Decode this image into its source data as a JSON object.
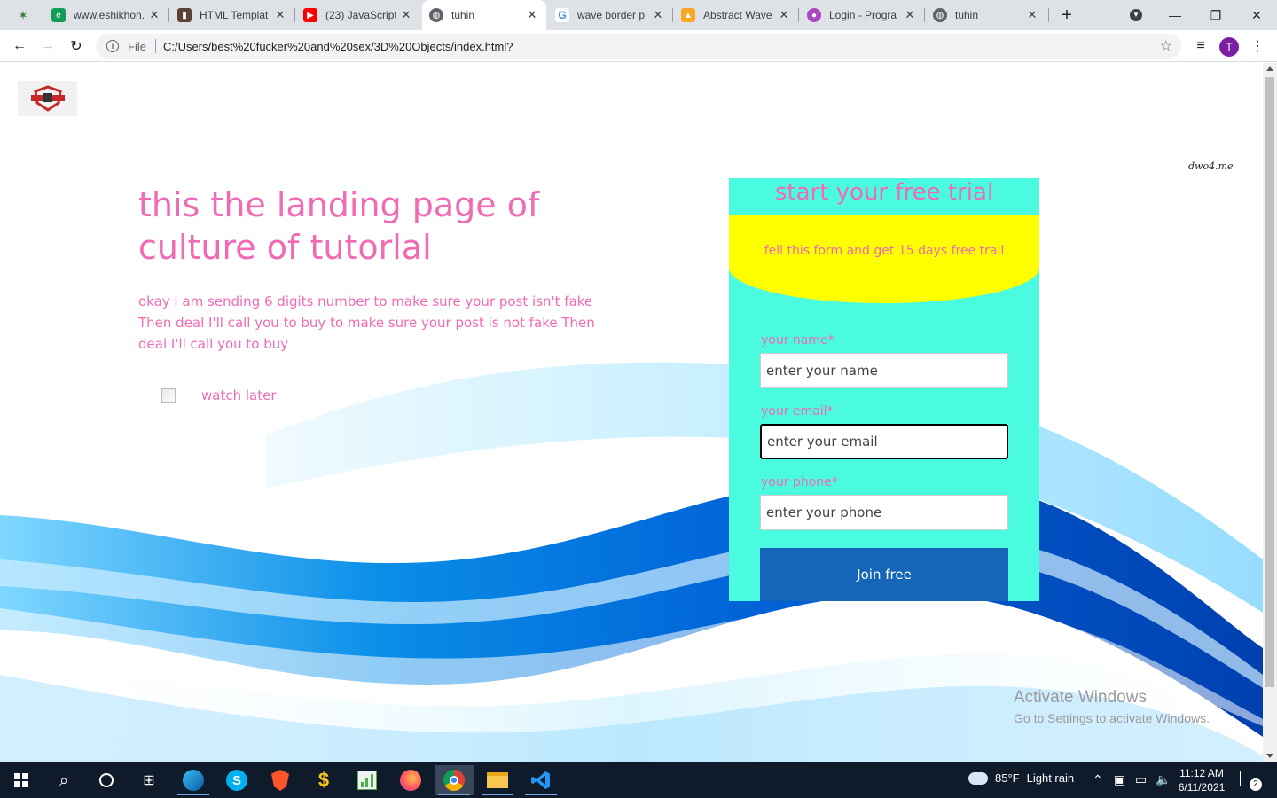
{
  "browser": {
    "tabs": [
      {
        "title": "",
        "favicon": "code-icon"
      },
      {
        "title": "www.eshikhon.",
        "favicon": "eshikhon-icon"
      },
      {
        "title": "HTML Templat",
        "favicon": "template-icon"
      },
      {
        "title": "(23) JavaScript",
        "favicon": "youtube-icon"
      },
      {
        "title": "tuhin",
        "favicon": "globe-icon",
        "active": true
      },
      {
        "title": "wave border p",
        "favicon": "google-icon"
      },
      {
        "title": "Abstract Wave",
        "favicon": "image-icon"
      },
      {
        "title": "Login - Progra",
        "favicon": "login-icon"
      },
      {
        "title": "tuhin",
        "favicon": "globe-icon"
      }
    ],
    "new_tab": "+",
    "url_scheme": "File",
    "url": "C:/Users/best%20fucker%20and%20sex/3D%20Objects/index.html?",
    "profile_initial": "T"
  },
  "page": {
    "brand_text": "dwo4.me",
    "hero_title": "this the landing page of culture of tutorlal",
    "hero_text": "okay i am sending 6 digits number to make sure your post isn't fake Then deal I'll call you to buy to make sure your post is not fake Then deal I'll call you to buy",
    "watch_later": "watch later",
    "form": {
      "title": "start your free trial",
      "subtitle": "fell this form and get 15 days free trail",
      "name_label": "your name*",
      "name_placeholder": "enter your name",
      "email_label": "your email*",
      "email_placeholder": "enter your email",
      "phone_label": "your phone*",
      "phone_placeholder": "enter your phone",
      "submit": "Join free"
    },
    "colors": {
      "pink_text": "#f06ab4",
      "card_bg": "#4bfbe0",
      "band_bg": "#ffff00",
      "button_bg": "#1565b8"
    }
  },
  "os_overlay": {
    "activate_title": "Activate Windows",
    "activate_sub": "Go to Settings to activate Windows."
  },
  "taskbar": {
    "weather_temp": "85°F",
    "weather_desc": "Light rain",
    "time": "11:12 AM",
    "date": "6/11/2021",
    "notification_count": "2"
  }
}
